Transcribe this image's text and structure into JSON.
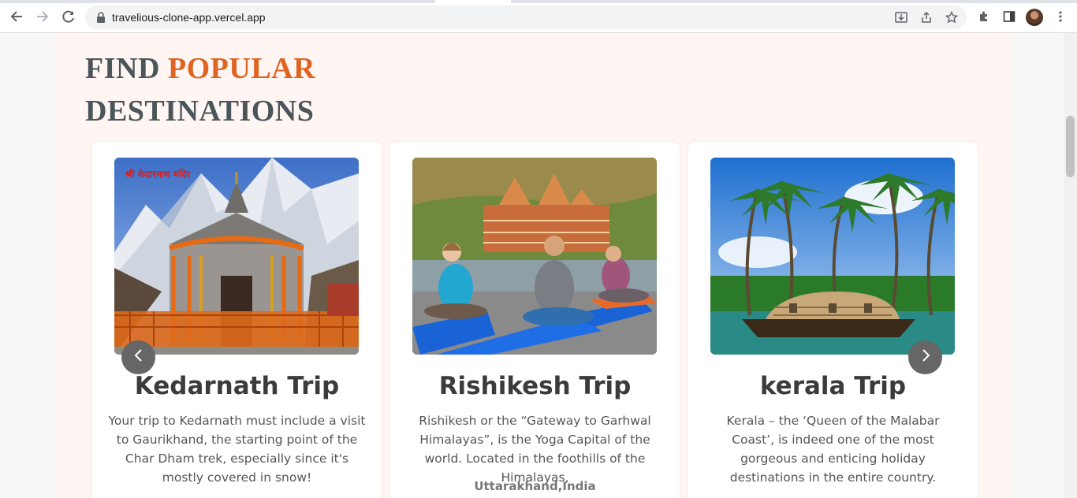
{
  "browser": {
    "url": "travelious-clone-app.vercel.app",
    "icons": [
      "back-icon",
      "forward-icon",
      "reload-icon",
      "lock-icon",
      "install-icon",
      "share-icon",
      "star-icon",
      "extensions-icon",
      "side-panel-icon",
      "avatar",
      "menu-icon"
    ]
  },
  "section": {
    "heading_word1": "FIND",
    "heading_accent": "POPULAR",
    "heading_line2": "DESTINATIONS",
    "accent_color": "#e0641f",
    "heading_color": "#4a5659"
  },
  "cards": [
    {
      "title": "Kedarnath Trip",
      "description": "Your trip to Kedarnath must include a visit to Gaurikhand, the starting point of the Char Dham trek, especially since it's mostly covered in snow!",
      "location": "",
      "photo_caption": "श्री केदारनाथ मंदिर"
    },
    {
      "title": "Rishikesh Trip",
      "description": "Rishikesh or the “Gateway to Garhwal Himalayas”, is the Yoga Capital of the world. Located in the foothills of the Himalayas,",
      "location": "Uttarakhand,India"
    },
    {
      "title": "kerala Trip",
      "description": "Kerala – the ‘Queen of the Malabar Coast’, is indeed one of the most gorgeous and enticing holiday destinations in the entire country.",
      "location": ""
    }
  ],
  "carousel": {
    "prev_icon": "chevron-left-icon",
    "next_icon": "chevron-right-icon"
  }
}
